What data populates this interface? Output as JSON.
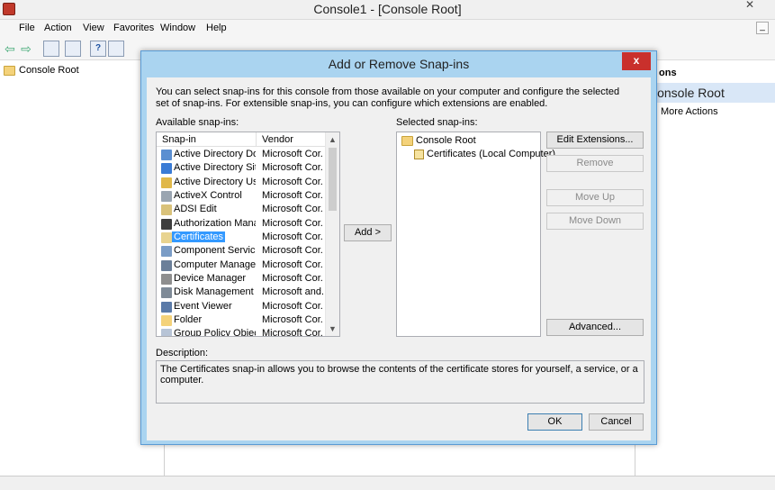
{
  "window": {
    "title": "Console1 - [Console Root]",
    "close_glyph": "✕",
    "mdi_glyph": "_"
  },
  "menu": [
    "File",
    "Action",
    "View",
    "Favorites",
    "Window",
    "Help"
  ],
  "toolbar": {
    "back": "⇦",
    "forward": "⇨",
    "help": "?"
  },
  "tree": {
    "root": "Console Root"
  },
  "actions": {
    "header": "ons",
    "selected": "Console Root",
    "more": "More Actions",
    "arrow": "▸"
  },
  "dialog": {
    "title": "Add or Remove Snap-ins",
    "close": "x",
    "intro": "You can select snap-ins for this console from those available on your computer and configure the selected set of snap-ins. For extensible snap-ins, you can configure which extensions are enabled.",
    "available_label": "Available snap-ins:",
    "selected_label": "Selected snap-ins:",
    "columns": {
      "snapin": "Snap-in",
      "vendor": "Vendor"
    },
    "snapins": [
      {
        "name": "Active Directory Do...",
        "vendor": "Microsoft Cor...",
        "color": "#5b8fd1"
      },
      {
        "name": "Active Directory Site...",
        "vendor": "Microsoft Cor...",
        "color": "#3a7bd5"
      },
      {
        "name": "Active Directory Use...",
        "vendor": "Microsoft Cor...",
        "color": "#e0b84a"
      },
      {
        "name": "ActiveX Control",
        "vendor": "Microsoft Cor...",
        "color": "#9aa5b1"
      },
      {
        "name": "ADSI Edit",
        "vendor": "Microsoft Cor...",
        "color": "#d9c27a"
      },
      {
        "name": "Authorization Manager",
        "vendor": "Microsoft Cor...",
        "color": "#3d3d3d"
      },
      {
        "name": "Certificates",
        "vendor": "Microsoft Cor...",
        "color": "#e8d38f"
      },
      {
        "name": "Component Services",
        "vendor": "Microsoft Cor...",
        "color": "#7a9cc6"
      },
      {
        "name": "Computer Managem...",
        "vendor": "Microsoft Cor...",
        "color": "#6b7f99"
      },
      {
        "name": "Device Manager",
        "vendor": "Microsoft Cor...",
        "color": "#8e8e8e"
      },
      {
        "name": "Disk Management",
        "vendor": "Microsoft and...",
        "color": "#7e8a97"
      },
      {
        "name": "Event Viewer",
        "vendor": "Microsoft Cor...",
        "color": "#5a7aa8"
      },
      {
        "name": "Folder",
        "vendor": "Microsoft Cor...",
        "color": "#f4d27a"
      },
      {
        "name": "Group Policy Object ...",
        "vendor": "Microsoft Cor...",
        "color": "#b7c4d6"
      }
    ],
    "selected_index": 6,
    "add_button": "Add >",
    "selected_tree": {
      "root": "Console Root",
      "child": "Certificates (Local Computer)"
    },
    "buttons": {
      "edit_extensions": "Edit Extensions...",
      "remove": "Remove",
      "move_up": "Move Up",
      "move_down": "Move Down",
      "advanced": "Advanced..."
    },
    "description_label": "Description:",
    "description": "The Certificates snap-in allows you to browse the contents of the certificate stores for yourself, a service, or a computer.",
    "ok": "OK",
    "cancel": "Cancel",
    "scroll_up": "▲",
    "scroll_down": "▼"
  }
}
